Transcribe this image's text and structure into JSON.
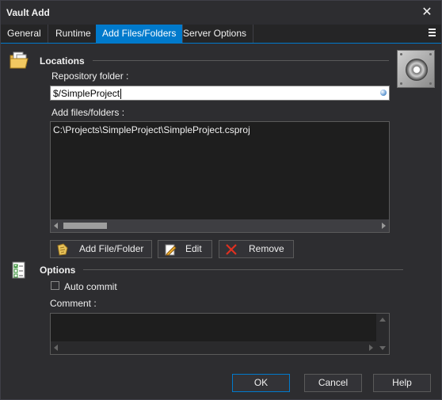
{
  "window": {
    "title": "Vault Add",
    "close_glyph": "✕"
  },
  "tabs": [
    {
      "label": "General",
      "active": false
    },
    {
      "label": "Runtime",
      "active": false
    },
    {
      "label": "Add Files/Folders",
      "active": true
    },
    {
      "label": "Server Options",
      "active": false
    }
  ],
  "locations": {
    "section_title": "Locations",
    "repository_label": "Repository folder :",
    "repository_value": "$/SimpleProject",
    "files_label": "Add files/folders :",
    "files": [
      "C:\\Projects\\SimpleProject\\SimpleProject.csproj"
    ],
    "add_button": "Add File/Folder",
    "edit_button": "Edit",
    "remove_button": "Remove"
  },
  "options": {
    "section_title": "Options",
    "auto_commit_label": "Auto commit",
    "auto_commit_checked": false,
    "comment_label": "Comment :",
    "comment_value": ""
  },
  "footer": {
    "ok": "OK",
    "cancel": "Cancel",
    "help": "Help"
  },
  "colors": {
    "accent": "#007acc",
    "background": "#2d2d30",
    "field": "#1e1e1e"
  },
  "icons": {
    "locations": "folder-documents-icon",
    "options": "checklist-icon",
    "vault": "vault-safe-icon",
    "add": "add-file-icon",
    "edit": "edit-icon",
    "remove": "remove-x-icon"
  }
}
